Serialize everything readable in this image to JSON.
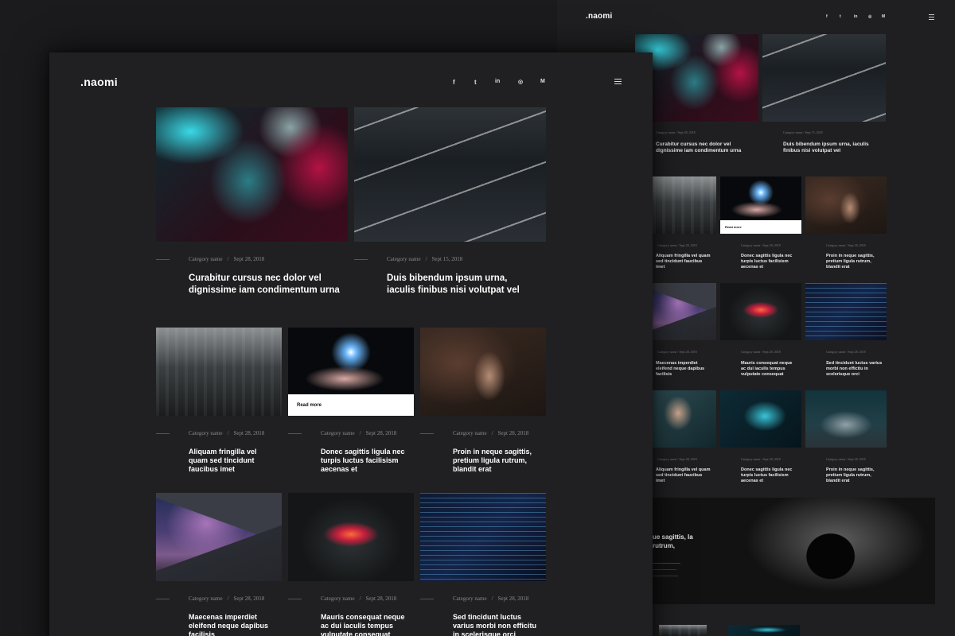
{
  "brand": {
    "logo": ".naomi"
  },
  "social": [
    {
      "label": "f",
      "icon": "facebook-icon"
    },
    {
      "label": "t",
      "icon": "twitter-icon"
    },
    {
      "label": "in",
      "icon": "linkedin-icon"
    },
    {
      "label": "◎",
      "icon": "instagram-icon"
    },
    {
      "label": "M",
      "icon": "medium-icon"
    }
  ],
  "front": {
    "featured": [
      {
        "category": "Category name",
        "date": "Sept 28, 2018",
        "title": "Curabitur cursus nec dolor vel dignissime iam condimentum urna"
      },
      {
        "category": "Category name",
        "date": "Sept 15, 2018",
        "title": "Duis bibendum ipsum urna, iaculis finibus nisi volutpat vel"
      }
    ],
    "row1": [
      {
        "category": "Category name",
        "date": "Sept 28, 2018",
        "title": "Aliquam fringilla vel quam sed tincidunt faucibus imet"
      },
      {
        "category": "Category name",
        "date": "Sept 28, 2018",
        "title": "Donec sagittis ligula nec turpis luctus facilisism aecenas et"
      },
      {
        "category": "Category name",
        "date": "Sept 28, 2018",
        "title": "Proin in neque sagittis, pretium ligula rutrum, blandit erat"
      }
    ],
    "row2": [
      {
        "category": "Category name",
        "date": "Sept 28, 2018",
        "title": "Maecenas imperdiet eleifend neque dapibus facilisis"
      },
      {
        "category": "Category name",
        "date": "Sept 28, 2018",
        "title": "Mauris consequat neque ac dui iaculis tempus vulputate consequat"
      },
      {
        "category": "Category name",
        "date": "Sept 28, 2018",
        "title": "Sed tincidunt luctus varius morbi non efficitu in scelerisque orci"
      }
    ],
    "read_more": "Read more"
  },
  "back": {
    "featured": [
      {
        "category": "Category name",
        "date": "Sept 28, 2018",
        "title": "Curabitur cursus nec dolor vel dignissime iam condimentum urna"
      },
      {
        "category": "Category name",
        "date": "Sept 15, 2018",
        "title": "Duis bibendum ipsum urna, iaculis finibus nisi volutpat vel"
      }
    ],
    "row1": [
      {
        "category": "Category name",
        "date": "Sept 28, 2018",
        "title": "Aliquam fringilla vel quam sed tincidunt faucibus imet"
      },
      {
        "category": "Category name",
        "date": "Sept 28, 2018",
        "title": "Donec sagittis ligula nec turpis luctus facilisism aecenas et"
      },
      {
        "category": "Category name",
        "date": "Sept 28, 2018",
        "title": "Proin in neque sagittis, pretium ligula rutrum, blandit erat"
      }
    ],
    "row2": [
      {
        "category": "Category name",
        "date": "Sept 28, 2018",
        "title": "Maecenas imperdiet eleifend neque dapibus facilisis"
      },
      {
        "category": "Category name",
        "date": "Sept 28, 2018",
        "title": "Mauris consequat neque ac dui iaculis tempus vulputate consequat"
      },
      {
        "category": "Category name",
        "date": "Sept 28, 2018",
        "title": "Sed tincidunt luctus varius morbi non efficitu in scelerisque orci"
      }
    ],
    "row3": [
      {
        "category": "Category name",
        "date": "Sept 28, 2018",
        "title": "Aliquam fringilla vel quam sed tincidunt faucibus imet"
      },
      {
        "category": "Category name",
        "date": "Sept 28, 2018",
        "title": "Donec sagittis ligula nec turpis luctus facilisism aecenas et"
      },
      {
        "category": "Category name",
        "date": "Sept 28, 2018",
        "title": "Proin in neque sagittis, pretium ligula rutrum, blandit erat"
      }
    ],
    "banner_title": "ue sagittis, la rutrum,",
    "read_more": "Read more"
  }
}
